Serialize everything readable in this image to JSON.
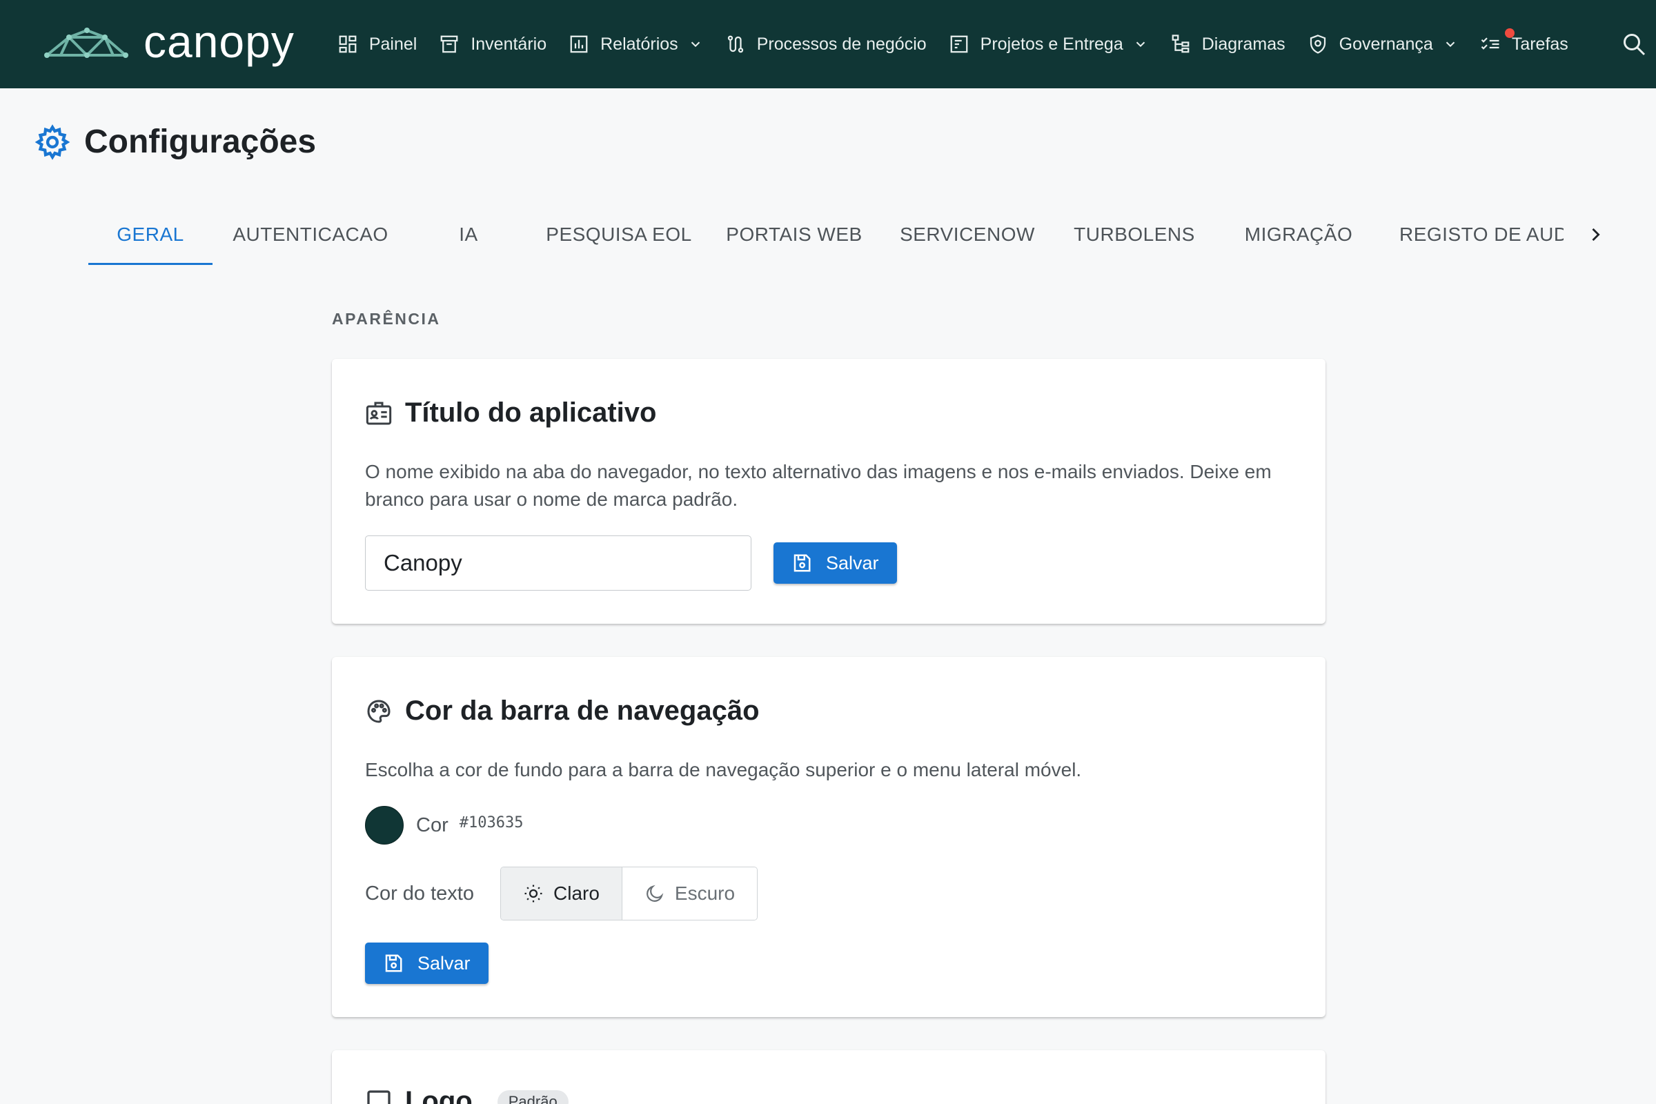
{
  "brand": {
    "name": "canopy",
    "icon": "canopy-logo-icon"
  },
  "nav": {
    "bg_color": "#103635",
    "items": [
      {
        "label": "Painel",
        "icon": "dashboard-icon"
      },
      {
        "label": "Inventário",
        "icon": "archive-box-icon"
      },
      {
        "label": "Relatórios",
        "icon": "chart-bar-icon",
        "dropdown": true
      },
      {
        "label": "Processos de negócio",
        "icon": "process-flow-icon"
      },
      {
        "label": "Projetos e Entrega",
        "icon": "project-icon",
        "dropdown": true
      },
      {
        "label": "Diagramas",
        "icon": "hierarchy-icon"
      },
      {
        "label": "Governança",
        "icon": "shield-icon",
        "dropdown": true
      },
      {
        "label": "Tarefas",
        "icon": "checklist-icon",
        "notification": true
      }
    ],
    "search_icon": "search-icon"
  },
  "page": {
    "title": "Configurações",
    "icon": "gear-icon"
  },
  "tabs": {
    "active_index": 0,
    "items": [
      "GERAL",
      "AUTENTICACAO",
      "IA",
      "PESQUISA EOL",
      "PORTAIS WEB",
      "SERVICENOW",
      "TURBOLENS",
      "MIGRAÇÃO",
      "REGISTO DE AUDITORIA"
    ]
  },
  "section": {
    "label": "APARÊNCIA"
  },
  "app_title_card": {
    "title": "Título do aplicativo",
    "icon": "id-card-icon",
    "description": "O nome exibido na aba do navegador, no texto alternativo das imagens e nos e-mails enviados. Deixe em branco para usar o nome de marca padrão.",
    "input_value": "Canopy",
    "save_label": "Salvar"
  },
  "navbar_color_card": {
    "title": "Cor da barra de navegação",
    "icon": "palette-icon",
    "description": "Escolha a cor de fundo para a barra de navegação superior e o menu lateral móvel.",
    "color_label": "Cor",
    "color_value": "#103635",
    "text_color_label": "Cor do texto",
    "options": [
      {
        "label": "Claro",
        "icon": "sun-icon",
        "selected": true
      },
      {
        "label": "Escuro",
        "icon": "moon-icon",
        "selected": false
      }
    ],
    "save_label": "Salvar"
  },
  "logo_card": {
    "title": "Logo",
    "badge": "Padrão",
    "icon": "image-icon"
  },
  "colors": {
    "accent": "#1976d2",
    "notification": "#ef4b3f"
  }
}
